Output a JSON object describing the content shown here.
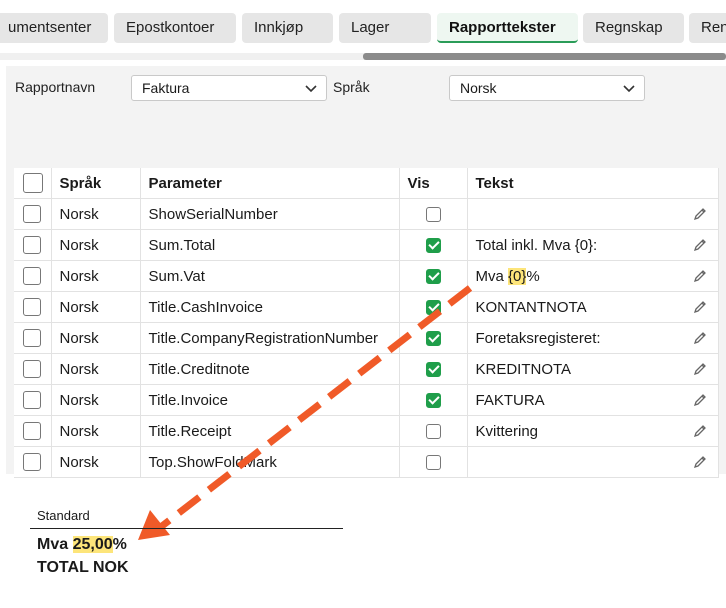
{
  "tabs": [
    {
      "label": "umentsenter"
    },
    {
      "label": "Epostkontoer"
    },
    {
      "label": "Innkjøp"
    },
    {
      "label": "Lager"
    },
    {
      "label": "Rapporttekster"
    },
    {
      "label": "Regnskap"
    },
    {
      "label": "Ren"
    }
  ],
  "filters": {
    "report_label": "Rapportnavn",
    "report_value": "Faktura",
    "language_label": "Språk",
    "language_value": "Norsk"
  },
  "table": {
    "headers": [
      "Språk",
      "Parameter",
      "Vis",
      "Tekst"
    ],
    "rows": [
      {
        "lang": "Norsk",
        "param": "ShowSerialNumber",
        "vis": false,
        "text": ""
      },
      {
        "lang": "Norsk",
        "param": "Sum.Total",
        "vis": true,
        "text": "Total inkl. Mva {0}:"
      },
      {
        "lang": "Norsk",
        "param": "Sum.Vat",
        "vis": true,
        "text_pre": "Mva ",
        "text_hl": "{0}",
        "text_post": "%"
      },
      {
        "lang": "Norsk",
        "param": "Title.CashInvoice",
        "vis": true,
        "text": "KONTANTNOTA"
      },
      {
        "lang": "Norsk",
        "param": "Title.CompanyRegistrationNumber",
        "vis": true,
        "text": "Foretaksregisteret:"
      },
      {
        "lang": "Norsk",
        "param": "Title.Creditnote",
        "vis": true,
        "text": "KREDITNOTA"
      },
      {
        "lang": "Norsk",
        "param": "Title.Invoice",
        "vis": true,
        "text": "FAKTURA"
      },
      {
        "lang": "Norsk",
        "param": "Title.Receipt",
        "vis": false,
        "text": "Kvittering"
      },
      {
        "lang": "Norsk",
        "param": "Top.ShowFoldMark",
        "vis": false,
        "text": ""
      }
    ]
  },
  "report_preview": {
    "header": "Standard",
    "vat_prefix": "Mva ",
    "vat_value": "25,00",
    "vat_suffix": "%",
    "total": "TOTAL NOK"
  },
  "colors": {
    "accent_green": "#1f9e4a",
    "highlight": "#fde57a",
    "arrow": "#f05a28"
  }
}
